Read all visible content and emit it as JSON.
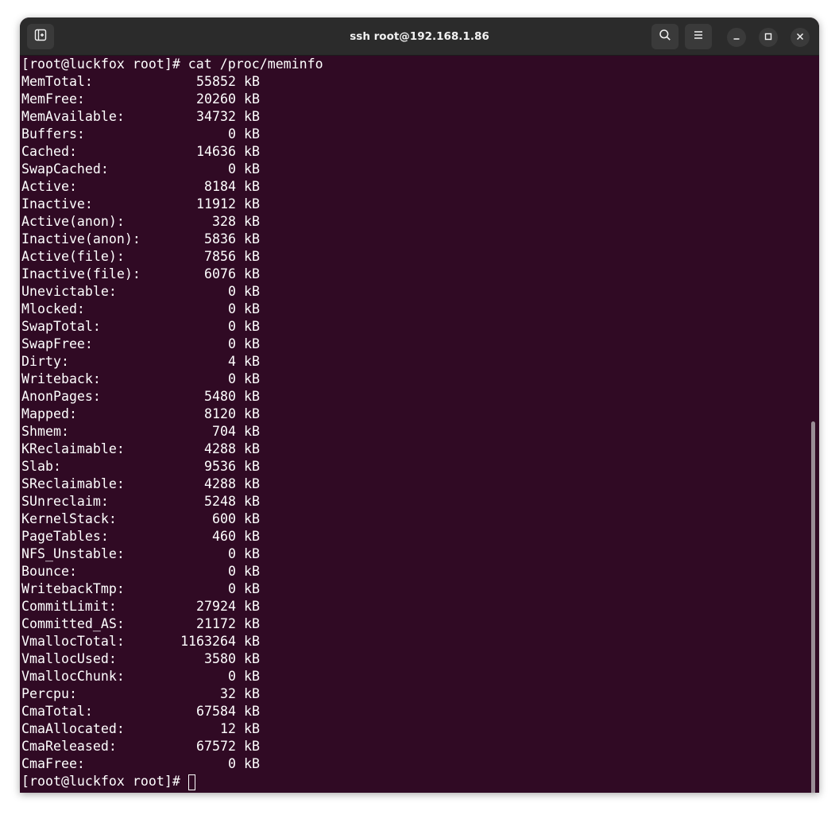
{
  "window": {
    "title": "ssh root@192.168.1.86"
  },
  "terminal": {
    "command_line": "[root@luckfox root]# cat /proc/meminfo",
    "prompt": "[root@luckfox root]#",
    "unit": "kB",
    "rows": [
      {
        "key": "MemTotal:",
        "value": "55852"
      },
      {
        "key": "MemFree:",
        "value": "20260"
      },
      {
        "key": "MemAvailable:",
        "value": "34732"
      },
      {
        "key": "Buffers:",
        "value": "0"
      },
      {
        "key": "Cached:",
        "value": "14636"
      },
      {
        "key": "SwapCached:",
        "value": "0"
      },
      {
        "key": "Active:",
        "value": "8184"
      },
      {
        "key": "Inactive:",
        "value": "11912"
      },
      {
        "key": "Active(anon):",
        "value": "328"
      },
      {
        "key": "Inactive(anon):",
        "value": "5836"
      },
      {
        "key": "Active(file):",
        "value": "7856"
      },
      {
        "key": "Inactive(file):",
        "value": "6076"
      },
      {
        "key": "Unevictable:",
        "value": "0"
      },
      {
        "key": "Mlocked:",
        "value": "0"
      },
      {
        "key": "SwapTotal:",
        "value": "0"
      },
      {
        "key": "SwapFree:",
        "value": "0"
      },
      {
        "key": "Dirty:",
        "value": "4"
      },
      {
        "key": "Writeback:",
        "value": "0"
      },
      {
        "key": "AnonPages:",
        "value": "5480"
      },
      {
        "key": "Mapped:",
        "value": "8120"
      },
      {
        "key": "Shmem:",
        "value": "704"
      },
      {
        "key": "KReclaimable:",
        "value": "4288"
      },
      {
        "key": "Slab:",
        "value": "9536"
      },
      {
        "key": "SReclaimable:",
        "value": "4288"
      },
      {
        "key": "SUnreclaim:",
        "value": "5248"
      },
      {
        "key": "KernelStack:",
        "value": "600"
      },
      {
        "key": "PageTables:",
        "value": "460"
      },
      {
        "key": "NFS_Unstable:",
        "value": "0"
      },
      {
        "key": "Bounce:",
        "value": "0"
      },
      {
        "key": "WritebackTmp:",
        "value": "0"
      },
      {
        "key": "CommitLimit:",
        "value": "27924"
      },
      {
        "key": "Committed_AS:",
        "value": "21172"
      },
      {
        "key": "VmallocTotal:",
        "value": "1163264"
      },
      {
        "key": "VmallocUsed:",
        "value": "3580"
      },
      {
        "key": "VmallocChunk:",
        "value": "0"
      },
      {
        "key": "Percpu:",
        "value": "32"
      },
      {
        "key": "CmaTotal:",
        "value": "67584"
      },
      {
        "key": "CmaAllocated:",
        "value": "12"
      },
      {
        "key": "CmaReleased:",
        "value": "67572"
      },
      {
        "key": "CmaFree:",
        "value": "0"
      }
    ]
  },
  "icons": {
    "new_tab": "new-tab-icon",
    "search": "search-icon",
    "menu": "hamburger-menu-icon",
    "minimize": "minimize-icon",
    "maximize": "maximize-icon",
    "close": "close-icon"
  },
  "colors": {
    "terminal_background": "#300a24",
    "terminal_foreground": "#ffffff",
    "titlebar": "#2b2b2b"
  }
}
